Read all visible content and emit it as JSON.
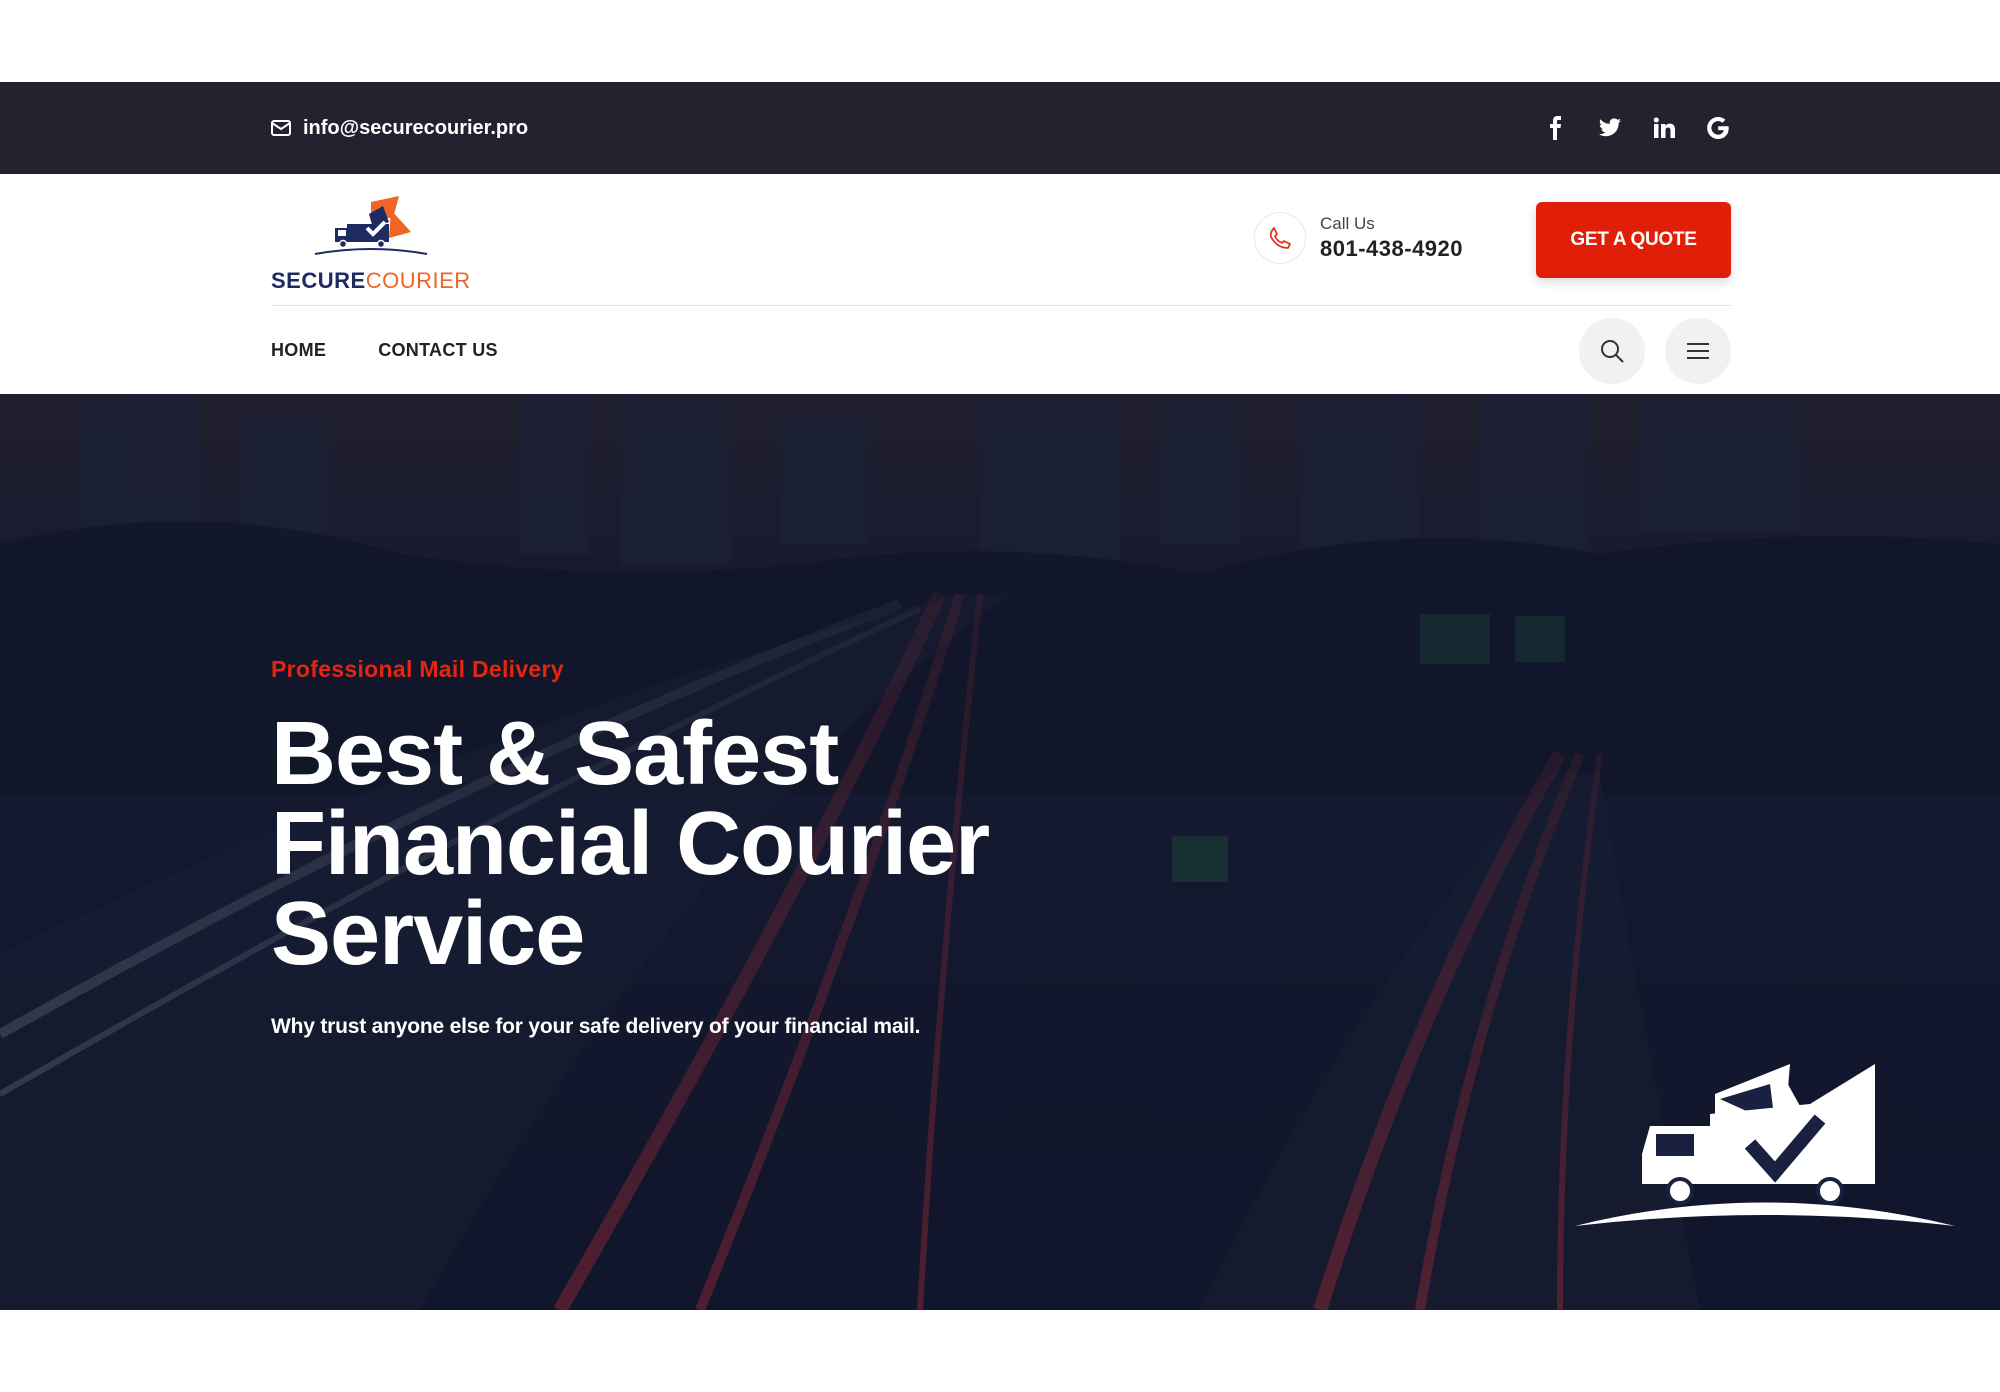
{
  "topbar": {
    "email": "info@securecourier.pro",
    "social": [
      {
        "icon": "facebook-icon"
      },
      {
        "icon": "twitter-icon"
      },
      {
        "icon": "linkedin-icon"
      },
      {
        "icon": "google-icon"
      }
    ]
  },
  "header": {
    "logo": {
      "part1": "SECURE",
      "part2": "COURIER"
    },
    "call": {
      "label": "Call Us",
      "number": "801-438-4920"
    },
    "quote_button": "GET A QUOTE"
  },
  "nav": {
    "items": [
      {
        "label": "HOME"
      },
      {
        "label": "CONTACT US"
      }
    ]
  },
  "hero": {
    "eyebrow": "Professional Mail Delivery",
    "headline": "Best & Safest Financial Courier Service",
    "subtitle": "Why trust anyone else for your safe delivery of your financial mail."
  },
  "colors": {
    "accent": "#e11e07",
    "topbar_bg": "#23232f",
    "hero_overlay": "#141a33",
    "logo_navy": "#1e2b63",
    "logo_orange": "#f06425"
  }
}
